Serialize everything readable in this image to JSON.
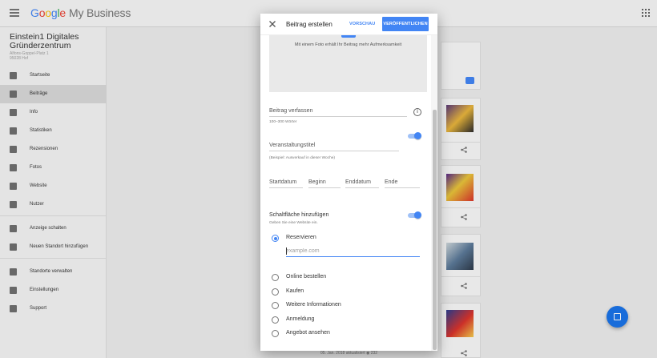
{
  "app": {
    "brand_google": [
      "G",
      "o",
      "o",
      "g",
      "l",
      "e"
    ],
    "brand_product": "My Business"
  },
  "business": {
    "name": "Einstein1 Digitales Gründerzentrum",
    "address_line1": "Alfons-Goppel-Platz 1",
    "address_line2": "95028 Hof"
  },
  "sidebar": {
    "items": [
      {
        "label": "Startseite",
        "icon": "home-icon"
      },
      {
        "label": "Beiträge",
        "icon": "posts-icon"
      },
      {
        "label": "Info",
        "icon": "info-store-icon"
      },
      {
        "label": "Statistiken",
        "icon": "insights-icon"
      },
      {
        "label": "Rezensionen",
        "icon": "star-icon"
      },
      {
        "label": "Fotos",
        "icon": "photos-icon"
      },
      {
        "label": "Website",
        "icon": "website-icon"
      },
      {
        "label": "Nutzer",
        "icon": "users-icon"
      },
      {
        "label": "Anzeige schalten",
        "icon": "ads-icon"
      },
      {
        "label": "Neuen Standort hinzufügen",
        "icon": "location-icon"
      },
      {
        "label": "Standorte verwalten",
        "icon": "locations-manage-icon"
      },
      {
        "label": "Einstellungen",
        "icon": "settings-icon"
      },
      {
        "label": "Support",
        "icon": "help-icon"
      }
    ],
    "active_index": 1
  },
  "dialog": {
    "title": "Beitrag erstellen",
    "preview_label": "VORSCHAU",
    "publish_label": "VERÖFFENTLICHEN",
    "photo_hint": "Mit einem Foto erhält Ihr Beitrag mehr Aufmerksamkeit",
    "compose_label": "Beitrag verfassen",
    "compose_helper": "100–300 Wörter",
    "event_title_label": "Veranstaltungstitel",
    "event_title_helper": "(Beispiel: Ausverkauf in dieser Woche)",
    "start_date_label": "Startdatum",
    "start_time_label": "Beginn",
    "end_date_label": "Enddatum",
    "end_time_label": "Ende",
    "button_toggle_label": "Schaltfläche hinzufügen",
    "button_toggle_helper": "Geben Sie eine Website ein.",
    "url_placeholder": "example.com",
    "url_value": "",
    "button_options": [
      "Reservieren",
      "Online bestellen",
      "Kaufen",
      "Weitere Informationen",
      "Anmeldung",
      "Angebot ansehen"
    ],
    "selected_option": "Reservieren",
    "event_toggle_on": true,
    "button_toggle_on": true
  },
  "background": {
    "footer_text": "05. Jan. 2018 aktualisiert",
    "footer_count": "232"
  },
  "colors": {
    "accent": "#4285f4",
    "fab": "#1a73e8"
  }
}
